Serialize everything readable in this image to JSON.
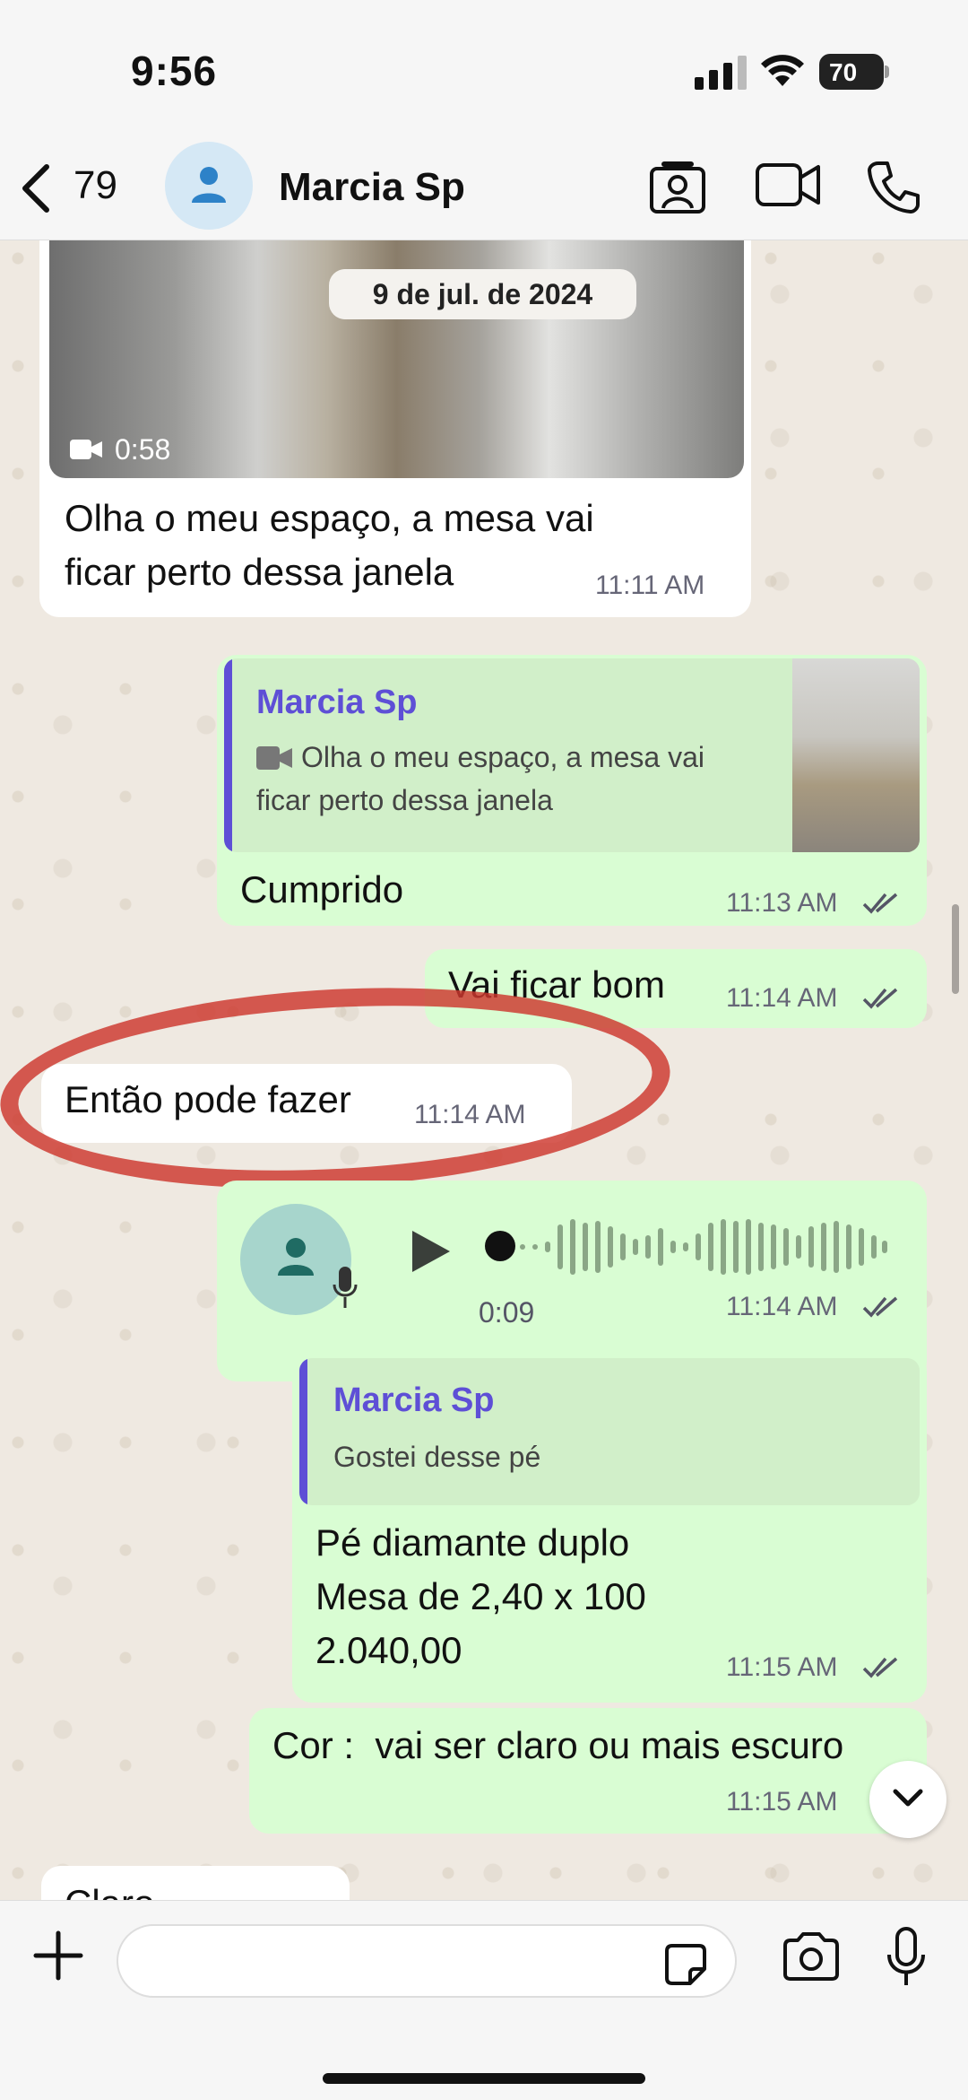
{
  "status_bar": {
    "time": "9:56",
    "battery": "70"
  },
  "header": {
    "back_count": "79",
    "contact_name": "Marcia Sp"
  },
  "chat": {
    "date_pill": "9 de jul. de 2024",
    "msg1": {
      "video_duration": "0:58",
      "text_line1": "Olha o meu espaço, a mesa vai",
      "text_line2": "ficar perto dessa janela",
      "time": "11:11 AM"
    },
    "msg2": {
      "quote_name": "Marcia Sp",
      "quote_line1": "Olha o meu espaço, a mesa vai",
      "quote_line2": "ficar perto dessa janela",
      "text": "Cumprido",
      "time": "11:13 AM"
    },
    "msg3": {
      "text": "Vai ficar bom",
      "time": "11:14 AM"
    },
    "msg4": {
      "text": "Então pode fazer",
      "time": "11:14 AM"
    },
    "msg5": {
      "duration": "0:09",
      "time": "11:14 AM"
    },
    "msg6": {
      "quote_name": "Marcia Sp",
      "quote_text": "Gostei desse pé",
      "line1": "Pé diamante duplo",
      "line2": "Mesa de 2,40 x 100",
      "line3": "2.040,00",
      "time": "11:15 AM"
    },
    "msg7": {
      "text": "Cor :  vai ser claro ou mais escuro",
      "time": "11:15 AM"
    },
    "msg8": {
      "text": "Claro"
    }
  },
  "colors": {
    "outgoing": "#d9fdd3",
    "incoming": "#ffffff",
    "accent": "#5e4fd6",
    "annotation": "#cd372d"
  },
  "icons": [
    "back-chevron-icon",
    "contact-avatar-icon",
    "contact-card-icon",
    "video-call-icon",
    "phone-icon",
    "plus-icon",
    "sticker-icon",
    "camera-icon",
    "mic-icon",
    "play-icon",
    "double-check-icon",
    "chevron-down-icon"
  ]
}
